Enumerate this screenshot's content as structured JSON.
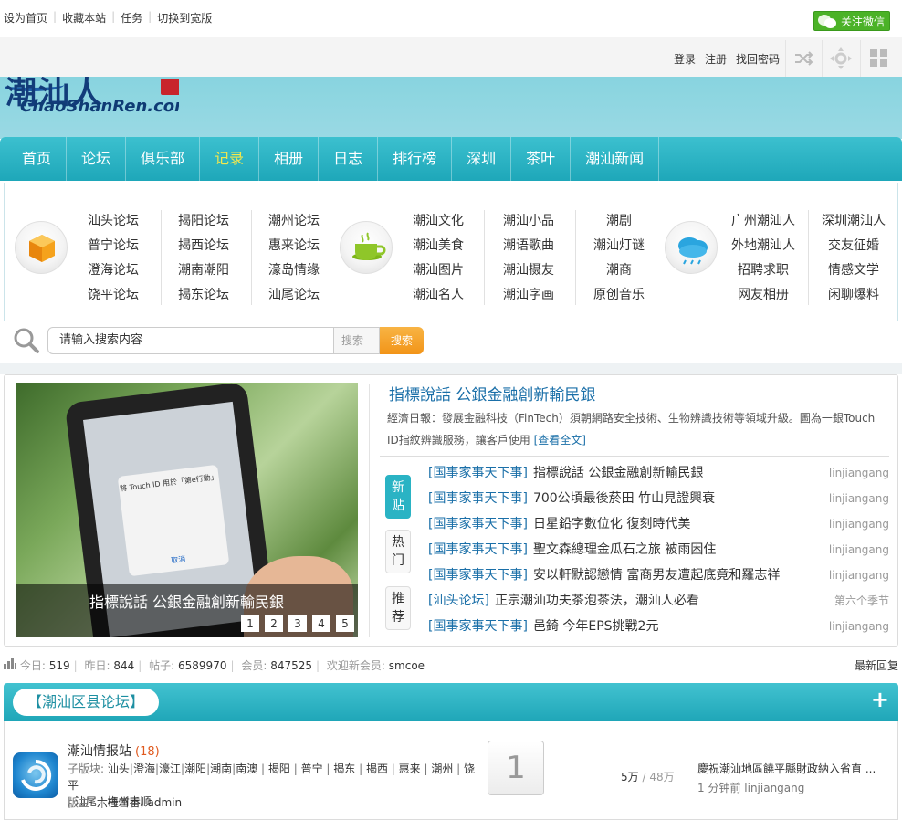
{
  "top": {
    "links": [
      "设为首页",
      "收藏本站",
      "任务",
      "切换到宽版"
    ],
    "wechat_label": "关注微信"
  },
  "user": {
    "links": [
      "登录",
      "注册",
      "找回密码"
    ]
  },
  "logo": {
    "cn": "潮汕人",
    "en": "ChaoShanRen.com"
  },
  "nav": {
    "items": [
      "首页",
      "论坛",
      "俱乐部",
      "记录",
      "相册",
      "日志",
      "排行榜",
      "深圳",
      "茶叶",
      "潮汕新闻"
    ],
    "active_index": 3
  },
  "categories": {
    "group1": [
      [
        "汕头论坛",
        "普宁论坛",
        "澄海论坛",
        "饶平论坛"
      ],
      [
        "揭阳论坛",
        "揭西论坛",
        "潮南潮阳",
        "揭东论坛"
      ],
      [
        "潮州论坛",
        "惠来论坛",
        "濠岛情缘",
        "汕尾论坛"
      ]
    ],
    "group2": [
      [
        "潮汕文化",
        "潮汕美食",
        "潮汕图片",
        "潮汕名人"
      ],
      [
        "潮汕小品",
        "潮语歌曲",
        "潮汕摄友",
        "潮汕字画"
      ],
      [
        "潮剧",
        "潮汕灯谜",
        "潮商",
        "原创音乐"
      ]
    ],
    "group3": [
      [
        "广州潮汕人",
        "外地潮汕人",
        "招聘求职",
        "网友相册"
      ],
      [
        "深圳潮汕人",
        "交友征婚",
        "情感文学",
        "闲聊爆料"
      ]
    ]
  },
  "search": {
    "placeholder": "请输入搜索内容",
    "scope": "搜索",
    "button": "搜索"
  },
  "slider": {
    "caption": "指標說話  公銀金融創新輸民銀",
    "pages": [
      "1",
      "2",
      "3",
      "4",
      "5"
    ],
    "dialog_title": "將 Touch ID 用於「第e行動」",
    "dialog_button": "取消"
  },
  "headline": {
    "title": "指標說話  公銀金融創新輸民銀",
    "summary": "經濟日報：發展金融科技（FinTech）須朝網路安全技術、生物辨識技術等領域升級。圖為一銀Touch ID指紋辨識服務，讓客戶使用",
    "more": "[查看全文]"
  },
  "tabs": [
    "新贴",
    "热门",
    "推荐"
  ],
  "news": [
    {
      "cat": "[国事家事天下事]",
      "title": "指標說話  公銀金融創新輸民銀",
      "author": "linjiangang"
    },
    {
      "cat": "[国事家事天下事]",
      "title": "700公頃最後菸田  竹山見證興衰",
      "author": "linjiangang"
    },
    {
      "cat": "[国事家事天下事]",
      "title": "日星鉛字數位化  復刻時代美",
      "author": "linjiangang"
    },
    {
      "cat": "[国事家事天下事]",
      "title": "聖文森總理金瓜石之旅  被雨困住",
      "author": "linjiangang"
    },
    {
      "cat": "[国事家事天下事]",
      "title": "安以軒默認戀情  富商男友遭起底竟和羅志祥",
      "author": "linjiangang"
    },
    {
      "cat": "[汕头论坛]",
      "title": "正宗潮汕功夫茶泡茶法，潮汕人必看",
      "author": "第六个季节"
    },
    {
      "cat": "[国事家事天下事]",
      "title": "邑錡  今年EPS挑戰2元",
      "author": "linjiangang"
    }
  ],
  "stats": {
    "today_label": "今日:",
    "today": "519",
    "yesterday_label": "昨日:",
    "yesterday": "844",
    "posts_label": "帖子:",
    "posts": "6589970",
    "members_label": "会员:",
    "members": "847525",
    "welcome_label": "欢迎新会员:",
    "newest": "smcoe",
    "latest_reply": "最新回复"
  },
  "forum_section": {
    "title": "【潮汕区县论坛】",
    "forum": {
      "name": "潮汕情报站",
      "count": "(18)",
      "sub_label": "子版块:",
      "subs": [
        "汕头",
        "澄海",
        "濠江",
        "潮阳",
        "潮南",
        "南澳",
        "揭阳",
        "普宁",
        "揭东",
        "揭西",
        "惠来",
        "潮州",
        "饶平",
        "汕尾",
        "梅州丰顺"
      ],
      "mod_label": "版主:",
      "moderators": "六桂首香, admin",
      "today": "1",
      "threads": "5万",
      "posts": "48万",
      "last_title": "慶祝潮汕地區饒平縣財政納入省直 ...",
      "last_time": "1 分钟前",
      "last_author": "linjiangang"
    }
  }
}
